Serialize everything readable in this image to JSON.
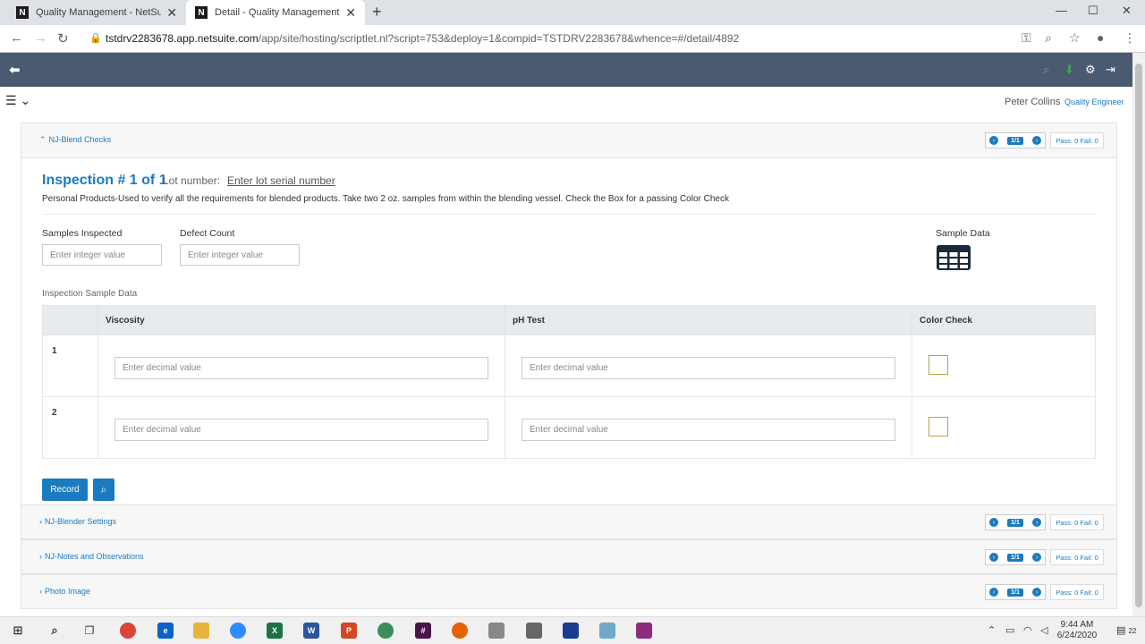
{
  "browser": {
    "tabs": [
      {
        "title": "Quality Management - NetSuite"
      },
      {
        "title": "Detail - Quality Management"
      }
    ],
    "url_host": "tstdrv2283678.app.netsuite.com",
    "url_path": "/app/site/hosting/scriptlet.nl?script=753&deploy=1&compid=TSTDRV2283678&whence=#/detail/4892"
  },
  "user": {
    "name": "Peter Collins",
    "role": "Quality Engineer"
  },
  "sections": [
    {
      "title": "NJ-Blend Checks",
      "pager": "1/1",
      "passfail": "Pass: 0 Fail: 0"
    },
    {
      "title": "NJ-Blender Settings",
      "pager": "1/1",
      "passfail": "Pass: 0 Fail: 0"
    },
    {
      "title": "NJ-Notes and Observations",
      "pager": "1/1",
      "passfail": "Pass: 0 Fail: 0"
    },
    {
      "title": "Photo Image",
      "pager": "1/1",
      "passfail": "Pass: 0 Fail: 0"
    }
  ],
  "inspection": {
    "title": "Inspection # 1 of 1",
    "lot_label": "Lot number:",
    "lot_link": "Enter lot serial number",
    "description": "Personal Products-Used to verify all the requirements for blended products. Take two 2 oz. samples from within the blending vessel. Check the Box for a passing Color Check",
    "samples_label": "Samples Inspected",
    "samples_placeholder": "Enter integer value",
    "defect_label": "Defect Count",
    "defect_placeholder": "Enter integer value",
    "sample_data_label": "Sample Data",
    "sample_data_section": "Inspection Sample Data",
    "columns": [
      "Viscosity",
      "pH Test",
      "Color Check"
    ],
    "rows": [
      {
        "num": "1",
        "placeholder": "Enter decimal value"
      },
      {
        "num": "2",
        "placeholder": "Enter decimal value"
      }
    ],
    "record_label": "Record"
  },
  "taskbar": {
    "time": "9:44 AM",
    "date": "6/24/2020",
    "notif_count": "22"
  }
}
